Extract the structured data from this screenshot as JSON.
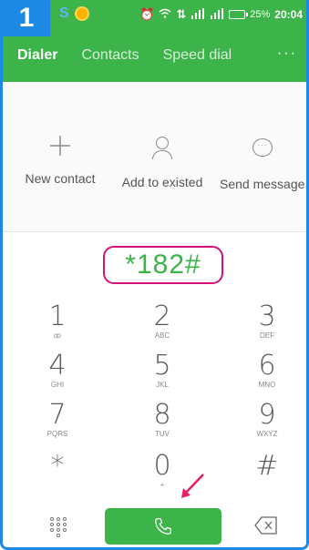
{
  "step_badge": "1",
  "status_bar": {
    "app_letter": "S",
    "battery_text": "25%",
    "time": "20:04"
  },
  "tabs": [
    {
      "label": "Dialer",
      "active": true
    },
    {
      "label": "Contacts",
      "active": false
    },
    {
      "label": "Speed dial",
      "active": false
    }
  ],
  "tabs_more": "···",
  "actions": {
    "new_contact": "New contact",
    "add_to_existed": "Add to existed",
    "send_message": "Send message"
  },
  "display": {
    "number": "*182#"
  },
  "keypad": {
    "k1": {
      "digit": "1",
      "letters": "ꝏ"
    },
    "k2": {
      "digit": "2",
      "letters": "ABC"
    },
    "k3": {
      "digit": "3",
      "letters": "DEF"
    },
    "k4": {
      "digit": "4",
      "letters": "GHI"
    },
    "k5": {
      "digit": "5",
      "letters": "JKL"
    },
    "k6": {
      "digit": "6",
      "letters": "MNO"
    },
    "k7": {
      "digit": "7",
      "letters": "PQRS"
    },
    "k8": {
      "digit": "8",
      "letters": "TUV"
    },
    "k9": {
      "digit": "9",
      "letters": "WXYZ"
    },
    "kstar": {
      "digit": "*",
      "letters": ""
    },
    "k0": {
      "digit": "0",
      "letters": "+"
    },
    "khash": {
      "digit": "#",
      "letters": ""
    }
  },
  "icons": {
    "new_contact": "plus-icon",
    "add_to_existed": "person-icon",
    "send_message": "chat-bubble-icon",
    "dialpad": "dialpad-grid-icon",
    "call": "phone-icon",
    "delete": "backspace-icon",
    "annotation": "arrow-icon"
  },
  "colors": {
    "accent_green": "#3cb449",
    "highlight_magenta": "#d5127a",
    "badge_blue": "#1e88e5"
  }
}
